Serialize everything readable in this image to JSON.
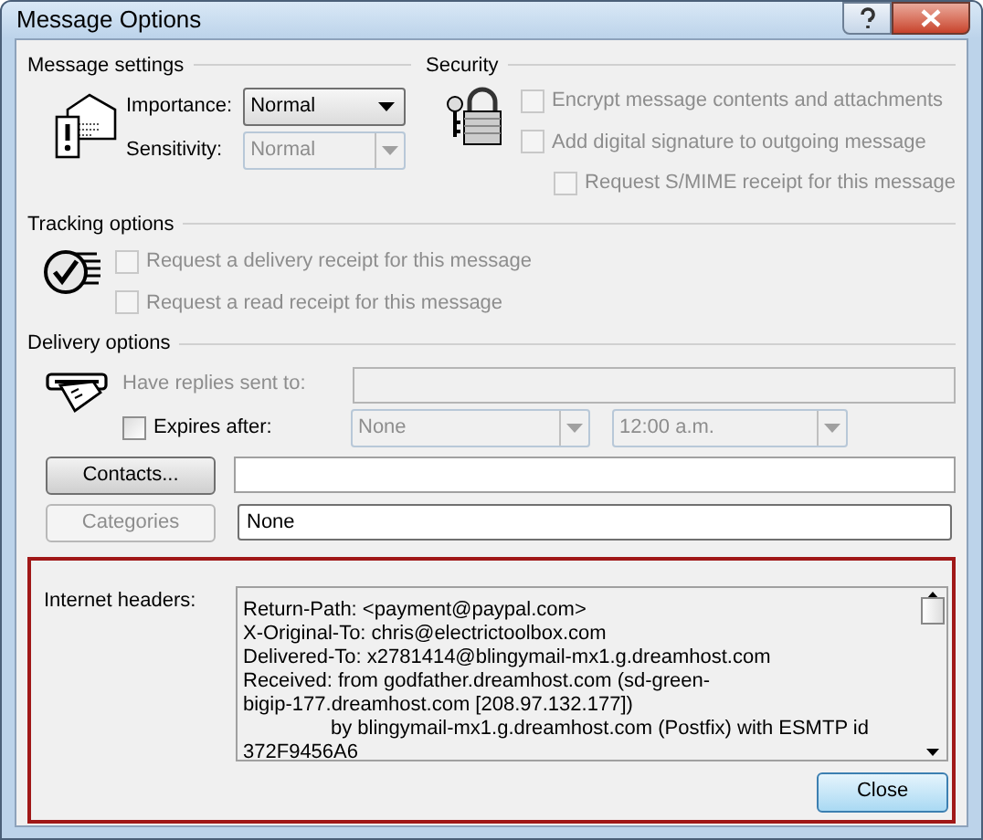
{
  "window": {
    "title": "Message Options"
  },
  "message_settings": {
    "heading": "Message settings",
    "fields": [
      {
        "label": "Importance:",
        "value": "Normal",
        "disabled": false
      },
      {
        "label": "Sensitivity:",
        "value": "Normal",
        "disabled": true
      }
    ]
  },
  "security": {
    "heading": "Security",
    "options": [
      {
        "label": "Encrypt message contents and attachments",
        "checked": false,
        "disabled": true
      },
      {
        "label": "Add digital signature to outgoing message",
        "checked": false,
        "disabled": true,
        "children": [
          {
            "label": "Request S/MIME receipt for this message",
            "checked": false,
            "disabled": true
          }
        ]
      }
    ]
  },
  "tracking": {
    "heading": "Tracking options",
    "options": [
      {
        "label": "Request a delivery receipt for this message",
        "checked": false,
        "disabled": true
      },
      {
        "label": "Request a read receipt for this message",
        "checked": false,
        "disabled": true
      }
    ]
  },
  "delivery": {
    "heading": "Delivery options",
    "replies": {
      "label": "Have replies sent to:",
      "disabled": true
    },
    "expires": {
      "label": "Expires after:",
      "checked": false,
      "date": "None",
      "time": "12:00 a.m.",
      "disabled": true
    }
  },
  "contacts": {
    "button": "Contacts...",
    "disabled": false
  },
  "categories": {
    "button": "Categories",
    "disabled": true,
    "value": "None"
  },
  "headers": {
    "label": "Internet headers:",
    "lines": [
      {
        "text": "Return-Path: <payment@paypal.com>",
        "indented": false
      },
      {
        "text": "X-Original-To: chris@electrictoolbox.com",
        "indented": false
      },
      {
        "text": "Delivered-To: x2781414@blingymail-mx1.g.dreamhost.com",
        "indented": false
      },
      {
        "text": "Received: from godfather.dreamhost.com (sd-green-",
        "indented": false
      },
      {
        "text": "bigip-177.dreamhost.com [208.97.132.177])",
        "indented": false
      },
      {
        "text": "by blingymail-mx1.g.dreamhost.com (Postfix) with ESMTP id",
        "indented": true
      },
      {
        "text": "372F9456A6",
        "indented": false
      }
    ]
  },
  "close_button": "Close"
}
